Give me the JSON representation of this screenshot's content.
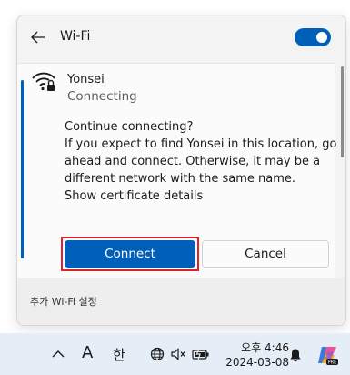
{
  "header": {
    "title": "Wi-Fi",
    "back_icon": "arrow-left-icon",
    "wifi_enabled": true,
    "accent": "#005fb8"
  },
  "network": {
    "name": "Yonsei",
    "status": "Connecting",
    "icon": "wifi-secured-icon"
  },
  "dialog": {
    "message_lines": [
      "Continue connecting?",
      "If you expect to find Yonsei in this location, go",
      "ahead and connect. Otherwise, it may be a",
      "different network with the same name.",
      "Show certificate details"
    ],
    "connect_label": "Connect",
    "cancel_label": "Cancel",
    "highlight_color": "#e0202a"
  },
  "footer": {
    "more_settings": "추가 Wi-Fi 설정"
  },
  "taskbar": {
    "ime_mode": "A",
    "ime_lang": "한",
    "time": "오후 4:46",
    "date": "2024-03-08",
    "icons": [
      "chevron-up-icon",
      "globe-icon",
      "speaker-muted-icon",
      "battery-icon",
      "bell-icon",
      "copilot-icon"
    ]
  }
}
